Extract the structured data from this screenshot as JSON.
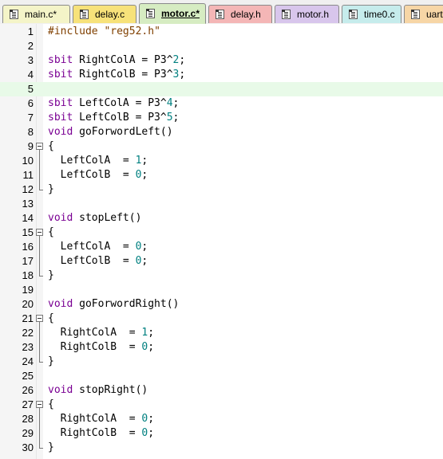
{
  "tabs": [
    {
      "label": "main.c*",
      "color": "#f4f4c8",
      "active": false
    },
    {
      "label": "delay.c",
      "color": "#f7e27a",
      "active": false
    },
    {
      "label": "motor.c*",
      "color": "#d6ecc2",
      "active": true
    },
    {
      "label": "delay.h",
      "color": "#f4b6b6",
      "active": false
    },
    {
      "label": "motor.h",
      "color": "#d8c6ec",
      "active": false
    },
    {
      "label": "time0.c",
      "color": "#c6ecec",
      "active": false
    },
    {
      "label": "uart",
      "color": "#f7d6a6",
      "active": false
    }
  ],
  "editor": {
    "highlighted_line": 5,
    "lines": [
      {
        "n": "1",
        "code": "#include \"reg52.h\""
      },
      {
        "n": "2",
        "code": ""
      },
      {
        "n": "3",
        "code": "sbit RightColA = P3^2;"
      },
      {
        "n": "4",
        "code": "sbit RightColB = P3^3;"
      },
      {
        "n": "5",
        "code": ""
      },
      {
        "n": "6",
        "code": "sbit LeftColA = P3^4;"
      },
      {
        "n": "7",
        "code": "sbit LeftColB = P3^5;"
      },
      {
        "n": "8",
        "code": "void goForwordLeft()"
      },
      {
        "n": "9",
        "code": "{"
      },
      {
        "n": "10",
        "code": "  LeftColA  = 1;"
      },
      {
        "n": "11",
        "code": "  LeftColB  = 0;"
      },
      {
        "n": "12",
        "code": "}"
      },
      {
        "n": "13",
        "code": ""
      },
      {
        "n": "14",
        "code": "void stopLeft()"
      },
      {
        "n": "15",
        "code": "{"
      },
      {
        "n": "16",
        "code": "  LeftColA  = 0;"
      },
      {
        "n": "17",
        "code": "  LeftColB  = 0;"
      },
      {
        "n": "18",
        "code": "}"
      },
      {
        "n": "19",
        "code": ""
      },
      {
        "n": "20",
        "code": "void goForwordRight()"
      },
      {
        "n": "21",
        "code": "{"
      },
      {
        "n": "22",
        "code": "  RightColA  = 1;"
      },
      {
        "n": "23",
        "code": "  RightColB  = 0;"
      },
      {
        "n": "24",
        "code": "}"
      },
      {
        "n": "25",
        "code": ""
      },
      {
        "n": "26",
        "code": "void stopRight()"
      },
      {
        "n": "27",
        "code": "{"
      },
      {
        "n": "28",
        "code": "  RightColA  = 0;"
      },
      {
        "n": "29",
        "code": "  RightColB  = 0;"
      },
      {
        "n": "30",
        "code": "}"
      }
    ]
  }
}
